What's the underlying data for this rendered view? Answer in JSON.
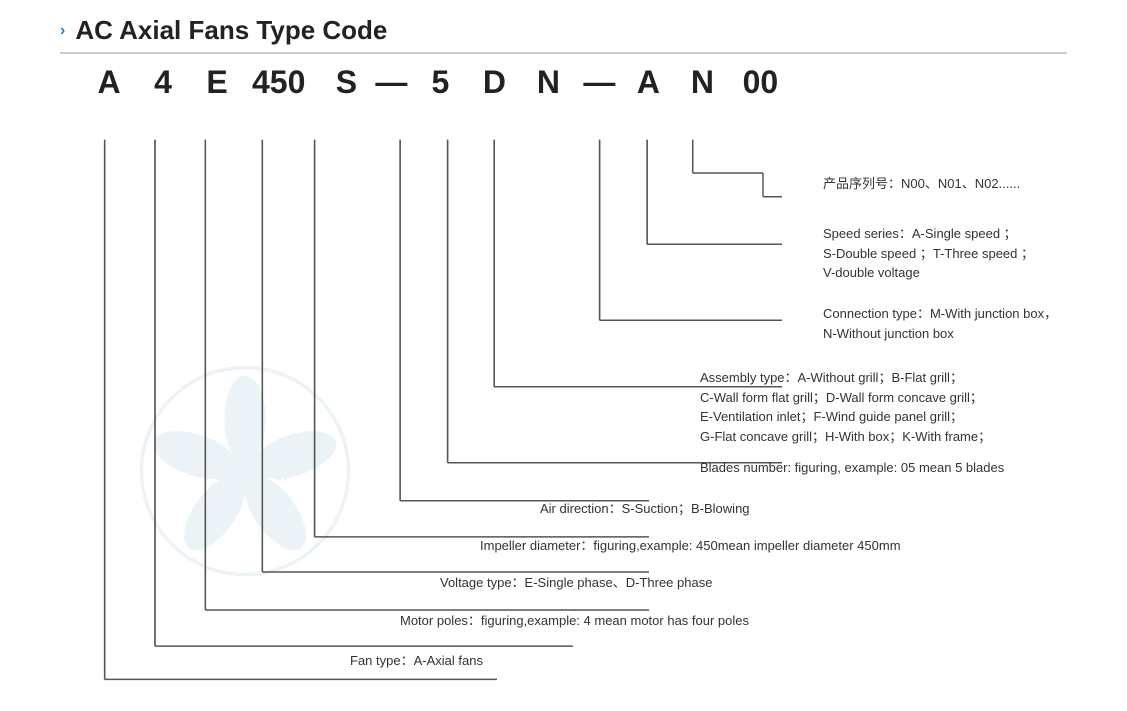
{
  "header": {
    "chevron": "›",
    "title": "AC Axial Fans Type Code"
  },
  "type_code": {
    "letters": [
      "A",
      "4",
      "E",
      "450",
      "S",
      "—",
      "5",
      "D",
      "N",
      "—",
      "A",
      "N",
      "00"
    ]
  },
  "labels": {
    "product_series": "产品序列号：N00、N01、N02......",
    "speed_series": "Speed series：A-Single speed ；",
    "speed_series2": "S-Double speed ；T-Three speed ；",
    "speed_series3": "V-double voltage",
    "connection_type": "Connection type：M-With junction box，",
    "connection_type2": "N-Without junction box",
    "assembly_type": "Assembly type：A-Without grill；B-Flat grill；",
    "assembly_type2": "C-Wall form flat grill；D-Wall form concave grill；",
    "assembly_type3": "E-Ventilation inlet；F-Wind guide panel grill；",
    "assembly_type4": "G-Flat concave grill；H-With box；K-With frame；",
    "blades_number": "Blades number: figuring, example: 05 mean 5 blades",
    "air_direction": "Air direction：S-Suction；B-Blowing",
    "impeller_diameter": "Impeller diameter：figuring,example: 450mean impeller diameter 450mm",
    "voltage_type": "Voltage type：E-Single phase、D-Three phase",
    "motor_poles": "Motor poles：figuring,example: 4 mean motor has four poles",
    "fan_type": "Fan type：A-Axial fans"
  }
}
